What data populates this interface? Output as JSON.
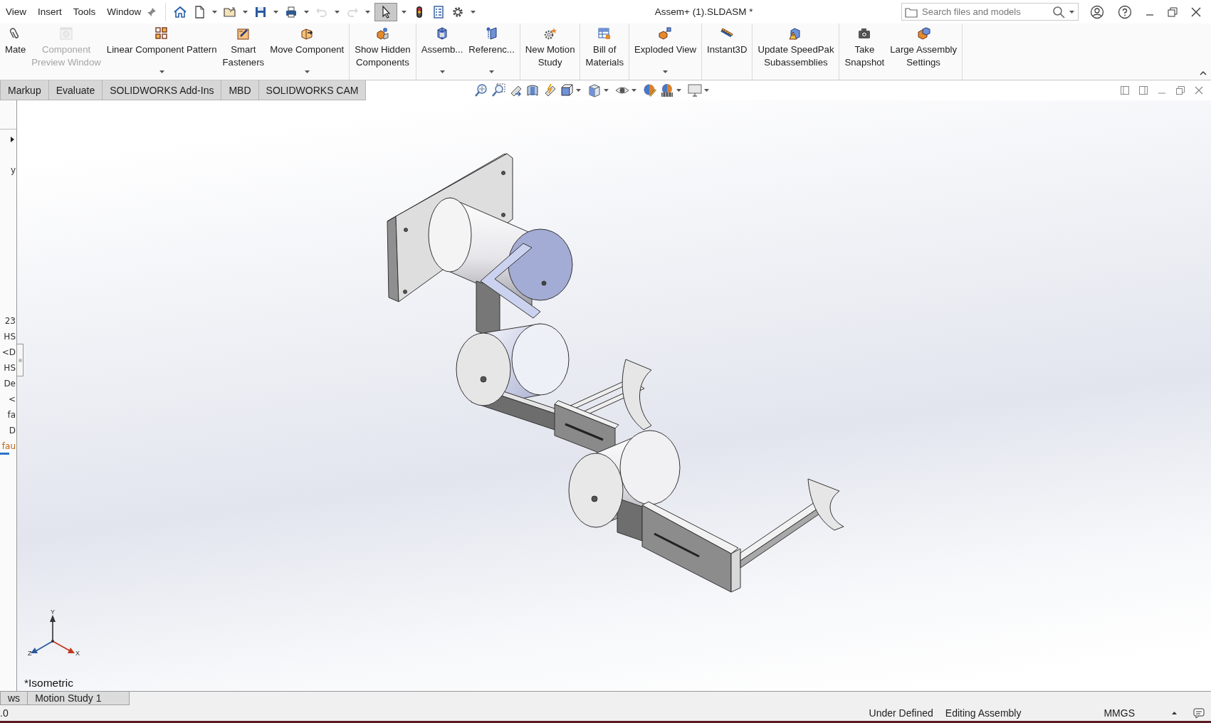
{
  "menu": [
    {
      "label": "View"
    },
    {
      "label": "Insert"
    },
    {
      "label": "Tools"
    },
    {
      "label": "Window"
    }
  ],
  "quick_tools": [
    {
      "dropdown": false,
      "disabled": false,
      "pressed": false
    },
    {
      "dropdown": true,
      "disabled": false,
      "pressed": false
    },
    {
      "dropdown": true,
      "disabled": false,
      "pressed": false
    },
    {
      "dropdown": true,
      "disabled": false,
      "pressed": false
    },
    {
      "dropdown": true,
      "disabled": false,
      "pressed": false
    },
    {
      "dropdown": true,
      "disabled": true,
      "pressed": false
    },
    {
      "dropdown": true,
      "disabled": true,
      "pressed": false
    },
    {
      "dropdown": true,
      "disabled": false,
      "pressed": true
    },
    {
      "dropdown": false,
      "disabled": false,
      "pressed": false
    },
    {
      "dropdown": false,
      "disabled": false,
      "pressed": false
    },
    {
      "dropdown": true,
      "disabled": false,
      "pressed": false
    }
  ],
  "title": "Assem+ (1).SLDASM *",
  "search": {
    "placeholder": "Search files and models"
  },
  "command_groups": [
    [
      {
        "lines": [
          "Mate"
        ],
        "disabled": false,
        "dropdown": false
      },
      {
        "lines": [
          "Component",
          "Preview Window"
        ],
        "disabled": true,
        "dropdown": false
      },
      {
        "lines": [
          "Linear Component Pattern"
        ],
        "disabled": false,
        "dropdown": true
      },
      {
        "lines": [
          "Smart",
          "Fasteners"
        ],
        "disabled": false,
        "dropdown": false
      },
      {
        "lines": [
          "Move Component"
        ],
        "disabled": false,
        "dropdown": true
      }
    ],
    [
      {
        "lines": [
          "Show Hidden",
          "Components"
        ],
        "disabled": false,
        "dropdown": false
      }
    ],
    [
      {
        "lines": [
          "Assemb..."
        ],
        "disabled": false,
        "dropdown": true
      },
      {
        "lines": [
          "Referenc..."
        ],
        "disabled": false,
        "dropdown": true
      }
    ],
    [
      {
        "lines": [
          "New Motion",
          "Study"
        ],
        "disabled": false,
        "dropdown": false
      }
    ],
    [
      {
        "lines": [
          "Bill of",
          "Materials"
        ],
        "disabled": false,
        "dropdown": false
      }
    ],
    [
      {
        "lines": [
          "Exploded View"
        ],
        "disabled": false,
        "dropdown": true
      }
    ],
    [
      {
        "lines": [
          "Instant3D"
        ],
        "disabled": false,
        "dropdown": false
      }
    ],
    [
      {
        "lines": [
          "Update SpeedPak",
          "Subassemblies"
        ],
        "disabled": false,
        "dropdown": false
      }
    ],
    [
      {
        "lines": [
          "Take",
          "Snapshot"
        ],
        "disabled": false,
        "dropdown": false
      },
      {
        "lines": [
          "Large Assembly",
          "Settings"
        ],
        "disabled": false,
        "dropdown": false
      }
    ]
  ],
  "tabs": [
    {
      "label": "Markup",
      "selected": false
    },
    {
      "label": "Evaluate",
      "selected": false
    },
    {
      "label": "SOLIDWORKS Add-Ins",
      "selected": false
    },
    {
      "label": "MBD",
      "selected": false
    },
    {
      "label": "SOLIDWORKS CAM",
      "selected": false
    }
  ],
  "left_panel": [
    {
      "text": "y",
      "color": "#333333"
    },
    {
      "text": "23",
      "color": "#333333"
    },
    {
      "text": "HS",
      "color": "#333333"
    },
    {
      "text": "<D",
      "color": "#333333"
    },
    {
      "text": "HS",
      "color": "#333333"
    },
    {
      "text": "De",
      "color": "#333333"
    },
    {
      "text": "<",
      "color": "#333333"
    },
    {
      "text": "fa",
      "color": "#333333"
    },
    {
      "text": "D",
      "color": "#333333"
    },
    {
      "text": "fau",
      "color": "#b8651a"
    }
  ],
  "triad": {
    "x": "X",
    "y": "Y",
    "z": "Z"
  },
  "view_label": "*Isometric",
  "bottom_tabs": [
    {
      "label": "ws",
      "selected": false
    },
    {
      "label": "Motion Study 1",
      "selected": false
    }
  ],
  "status": {
    "left": ".0",
    "items": [
      "Under Defined",
      "Editing Assembly"
    ],
    "units": "MMGS"
  }
}
